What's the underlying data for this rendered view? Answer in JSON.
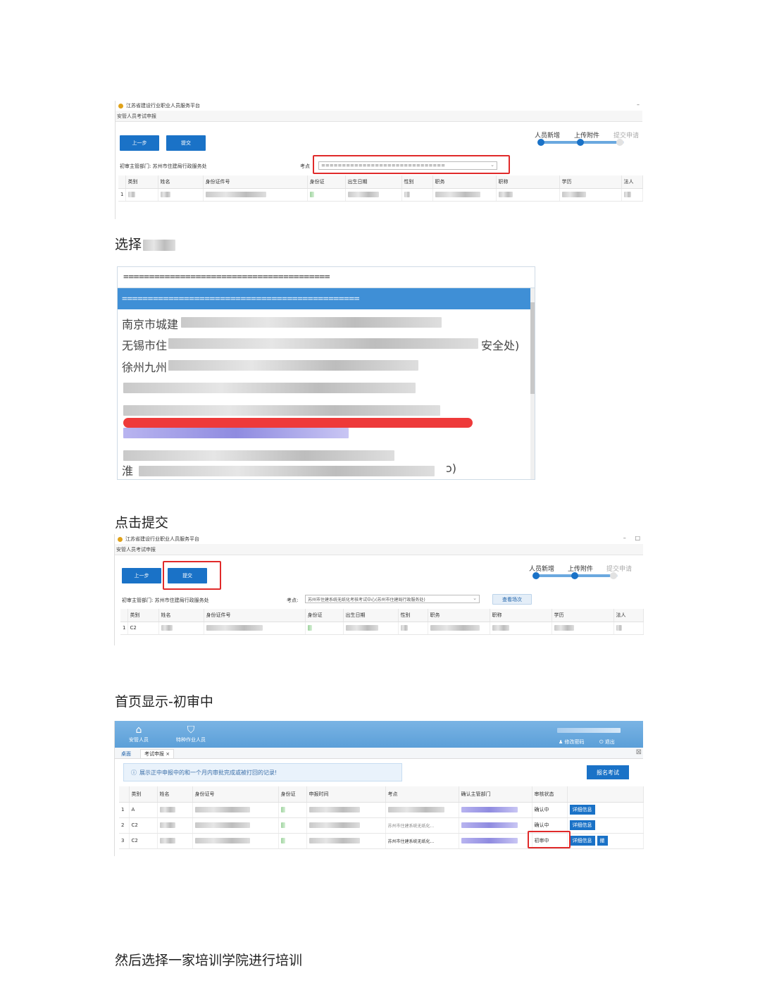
{
  "window": {
    "app_title": "江苏省建设行业职业人员服务平台",
    "page_title": "安管人员考试申报",
    "minimize": "–",
    "maximize": "□"
  },
  "steps": [
    "人员新增",
    "上传附件",
    "提交申请"
  ],
  "buttons": {
    "prev": "上一步",
    "submit": "提交",
    "view_sessions": "查看场次"
  },
  "form": {
    "dept_label": "初审主管部门:",
    "dept_value": "苏州市住建局行政服务处",
    "site_label": "考点",
    "site_label_colon": "考点:",
    "site_placeholder": "==============================",
    "site_selected": "苏州市住建系统无纸化考核考试中心(苏州市住建局行政服务处)"
  },
  "table": {
    "headers": [
      "类别",
      "姓名",
      "身份证件号",
      "身份证",
      "出生日期",
      "性别",
      "职务",
      "职称",
      "学历",
      "法人"
    ],
    "row_index": "1",
    "row_category": "C2"
  },
  "captions": {
    "select": "选择",
    "click_submit": "点击提交",
    "home_status": "首页显示-初审中",
    "training": "然后选择一家培训学院进行培训"
  },
  "dropdown": {
    "placeholder": "========================================",
    "selected": "==============================================",
    "options": [
      "南京市城建",
      "无锡市住",
      "徐州九州",
      "淮"
    ],
    "option_suffix_2": "安全处)",
    "option_suffix_last": "ɔ)"
  },
  "home": {
    "nav": [
      "安管人员",
      "特种作业人员"
    ],
    "right_links": [
      "修改密码",
      "退出"
    ],
    "tabs": [
      "桌面",
      "考试申报"
    ],
    "tab_close": "×",
    "notice": "展示正中申报中的和一个月内审批完成或被打回的记录!",
    "register_button": "报名考试",
    "headers": [
      "类别",
      "姓名",
      "身份证号",
      "身份证",
      "申报时间",
      "考点",
      "确认主管部门",
      "审核状态"
    ],
    "rows": [
      {
        "index": "1",
        "category": "A",
        "site": "",
        "status": "确认中"
      },
      {
        "index": "2",
        "category": "C2",
        "site": "苏州市住建系统无纸化...",
        "status": "确认中"
      },
      {
        "index": "3",
        "category": "C2",
        "site": "苏州市住建系统无纸化...",
        "status": "初审中"
      }
    ],
    "detail_button": "详细信息",
    "withdraw_button": "撤"
  },
  "colors": {
    "accent": "#1a72c7",
    "highlight_red": "#e02a2a",
    "header_blue": "#6aa8df"
  }
}
